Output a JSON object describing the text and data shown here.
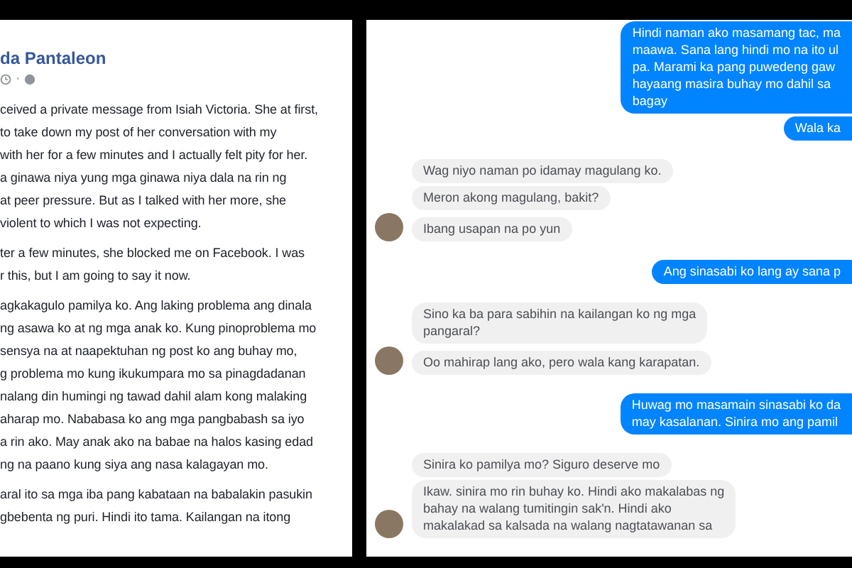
{
  "post": {
    "author": "da Pantaleon",
    "separator": "·",
    "paragraphs": [
      [
        "ceived a private message from Isiah Victoria. She at first,",
        "to take down my post of her conversation with my",
        "with her for a few minutes and I actually felt pity for her.",
        "a ginawa niya yung mga ginawa niya dala na rin ng",
        "at peer pressure. But as I talked with her more, she",
        "violent to which I was not expecting."
      ],
      [
        "ter a few minutes, she blocked me on Facebook. I was",
        "r this, but I am going to say it now."
      ],
      [
        "agkakagulo pamilya ko. Ang laking problema ang dinala",
        "ng asawa ko at ng mga anak ko. Kung pinoproblema mo",
        "sensya na at naapektuhan ng post ko ang buhay mo,",
        "g problema mo kung ikukumpara mo sa pinagdadanan",
        "nalang din humingi ng tawad dahil alam kong malaking",
        "aharap mo. Nababasa ko ang mga pangbabash sa iyo",
        "a rin ako. May anak ako na babae na halos kasing edad",
        "ng na paano kung siya ang nasa kalagayan mo."
      ],
      [
        "aral ito sa mga iba pang kabataan na babalakin pasukin",
        "gbebenta ng puri. Hindi ito tama. Kailangan na itong"
      ]
    ]
  },
  "chat": {
    "messages": [
      {
        "kind": "sent",
        "avatar": false,
        "lines": [
          "Hindi naman ako masamang tac, ma",
          "maawa. Sana lang hindi mo na ito ul",
          "pa. Marami ka pang puwedeng gaw",
          "hayaang masira buhay mo dahil sa",
          "bagay"
        ]
      },
      {
        "kind": "sent",
        "avatar": false,
        "lines": [
          "Wala ka"
        ]
      },
      {
        "kind": "received",
        "avatar": false,
        "lines": [
          "Wag niyo naman po idamay magulang ko."
        ]
      },
      {
        "kind": "received",
        "avatar": false,
        "lines": [
          "Meron akong magulang, bakit?"
        ]
      },
      {
        "kind": "received",
        "avatar": true,
        "lines": [
          "Ibang usapan na po yun"
        ]
      },
      {
        "kind": "sent",
        "avatar": false,
        "lines": [
          "Ang sinasabi ko lang ay sana p"
        ]
      },
      {
        "kind": "received",
        "avatar": false,
        "lines": [
          "Sino ka ba para sabihin na kailangan ko ng mga",
          "pangaral?"
        ]
      },
      {
        "kind": "received",
        "avatar": true,
        "lines": [
          "Oo mahirap lang ako, pero wala kang karapatan."
        ]
      },
      {
        "kind": "sent",
        "avatar": false,
        "lines": [
          "Huwag mo masamain sinasabi ko da",
          "may kasalanan. Sinira mo ang pamil"
        ]
      },
      {
        "kind": "received",
        "avatar": false,
        "lines": [
          "Sinira ko pamilya mo? Siguro deserve mo"
        ]
      },
      {
        "kind": "received",
        "avatar": true,
        "lines": [
          "Ikaw. sinira mo rin buhay ko. Hindi ako makalabas ng",
          "bahay na walang tumitingin sak'n. Hindi ako",
          "makalakad sa kalsada na walang nagtatawanan sa"
        ]
      }
    ]
  }
}
